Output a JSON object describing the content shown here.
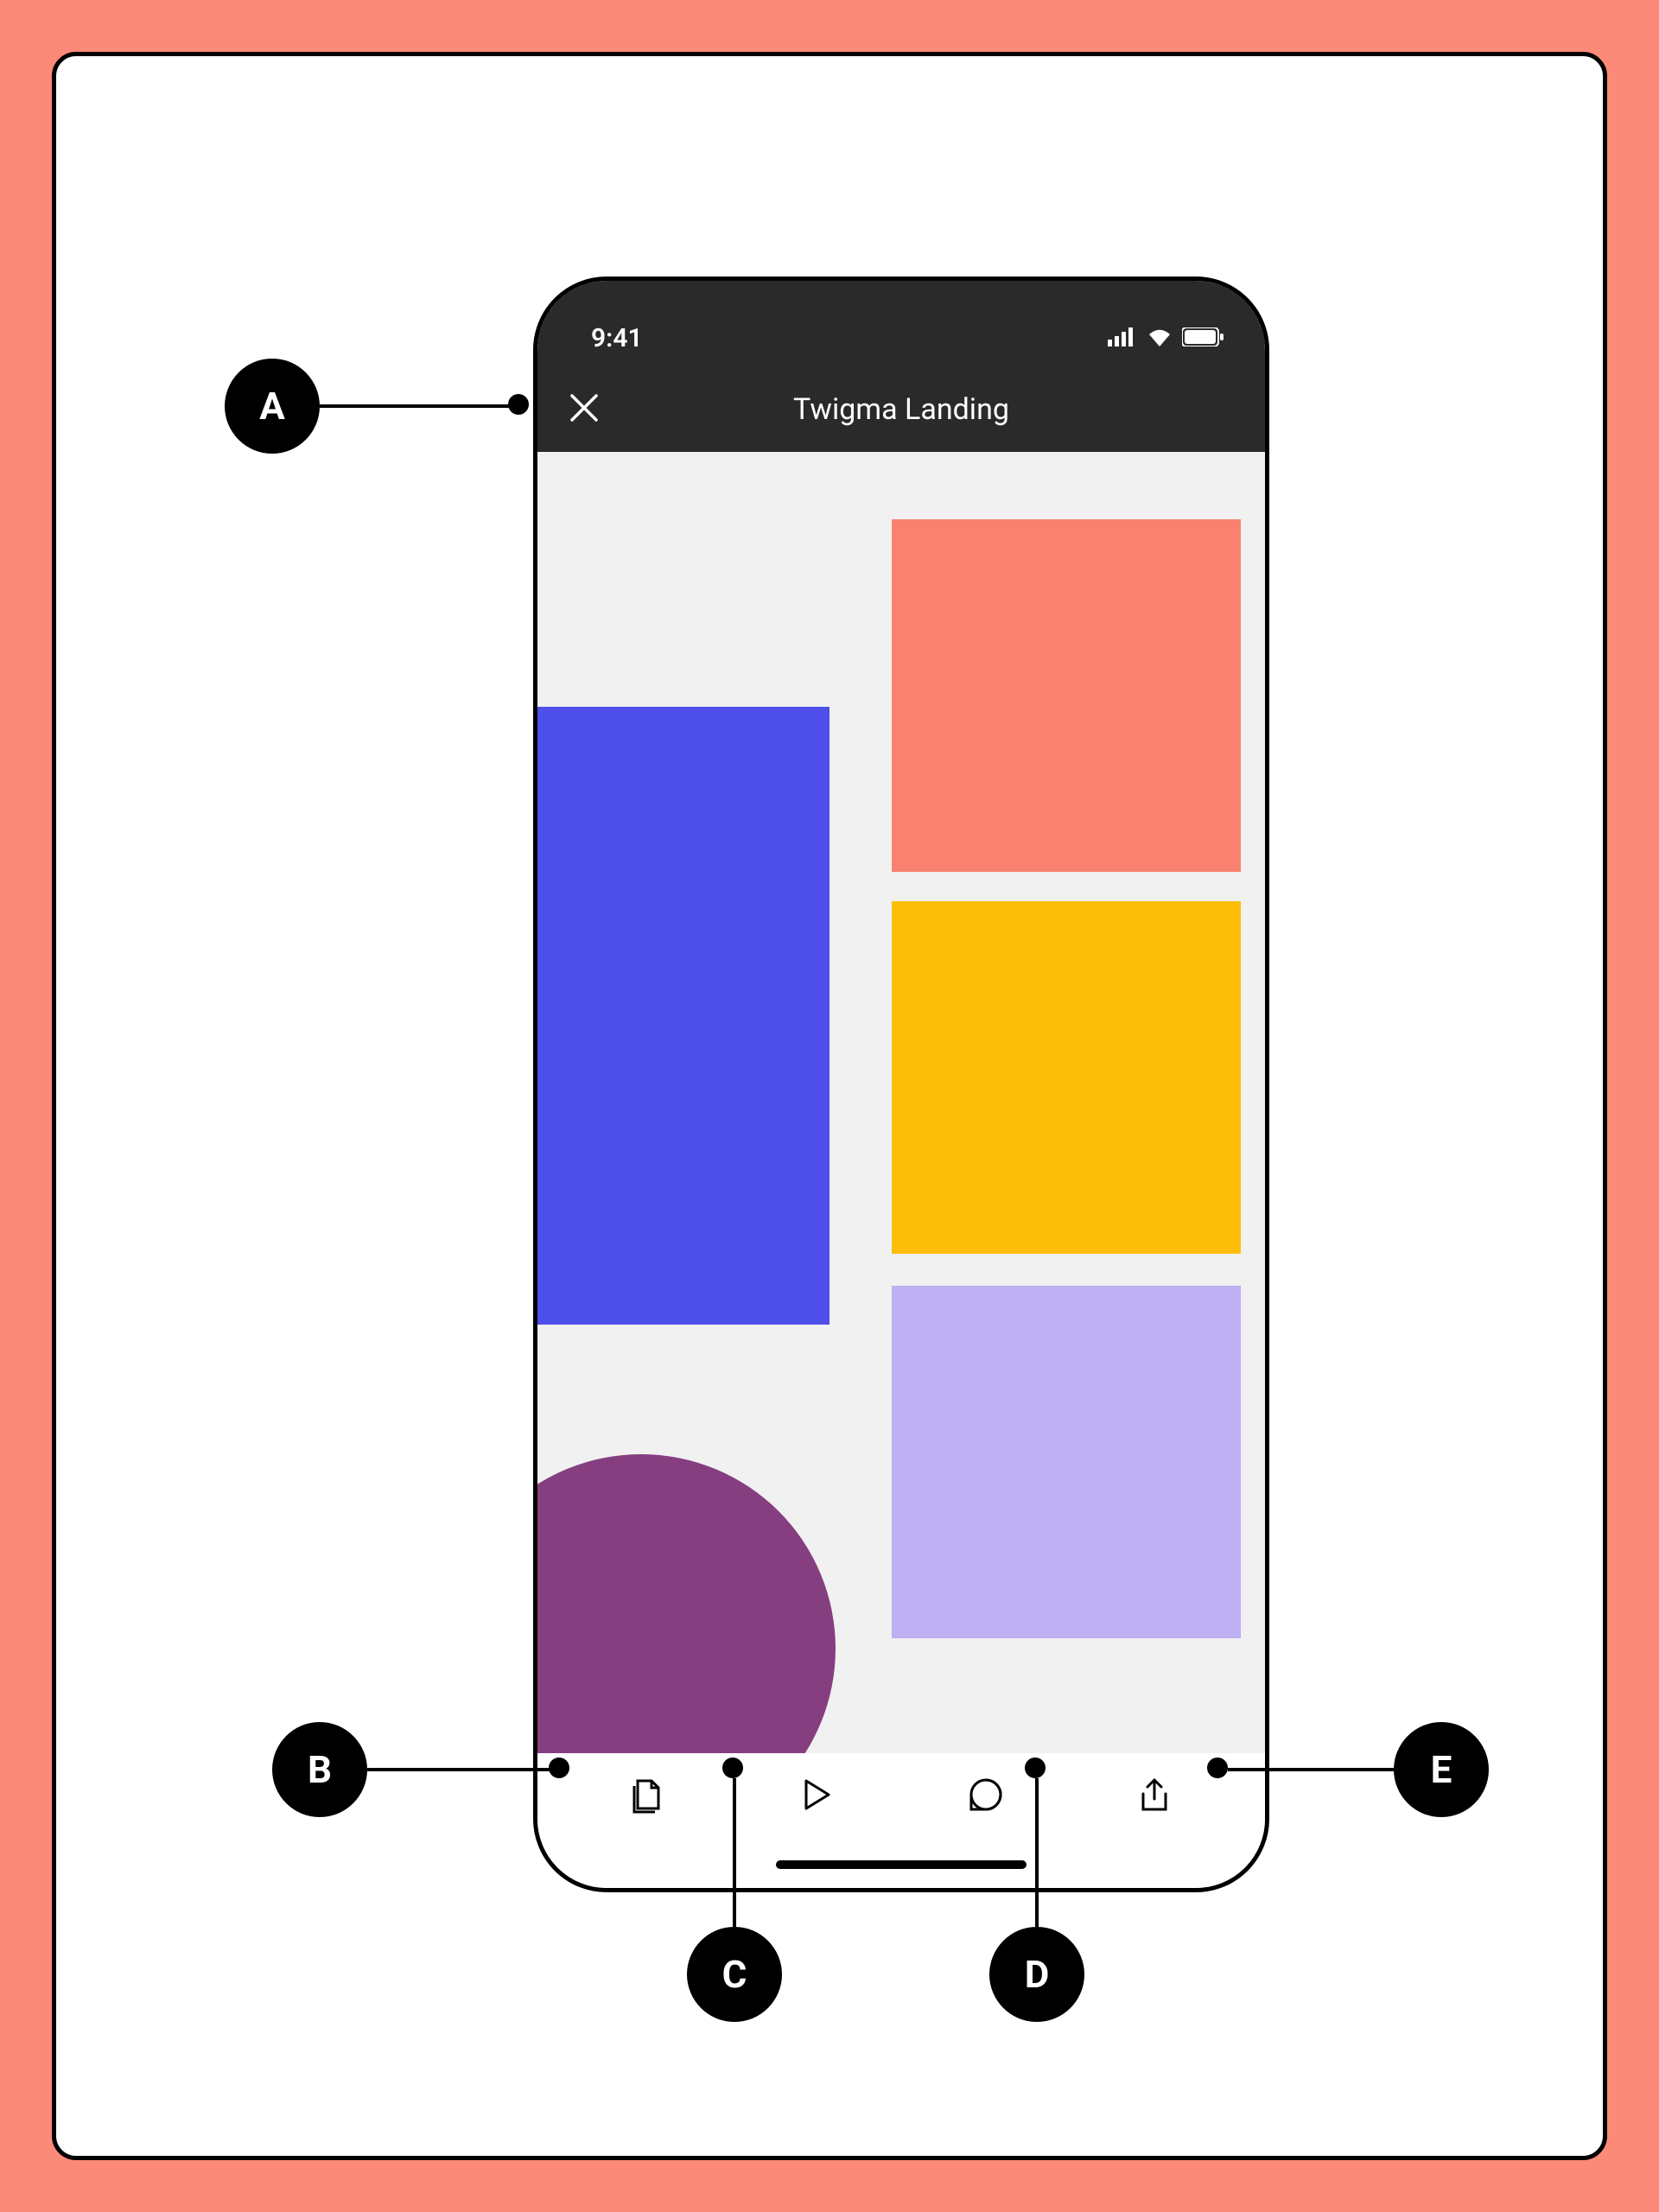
{
  "status": {
    "time": "9:41"
  },
  "header": {
    "title": "Twigma Landing"
  },
  "callouts": {
    "a": "A",
    "b": "B",
    "c": "C",
    "d": "D",
    "e": "E"
  },
  "canvas_shapes": {
    "blue": "#4F4FE9",
    "coral": "#F88170",
    "yellow": "#FDBE0A",
    "lavender": "#BEB0F2",
    "purple": "#853F81"
  },
  "toolbar": {
    "pages_label": "pages",
    "play_label": "play",
    "comments_label": "comments",
    "share_label": "share"
  }
}
